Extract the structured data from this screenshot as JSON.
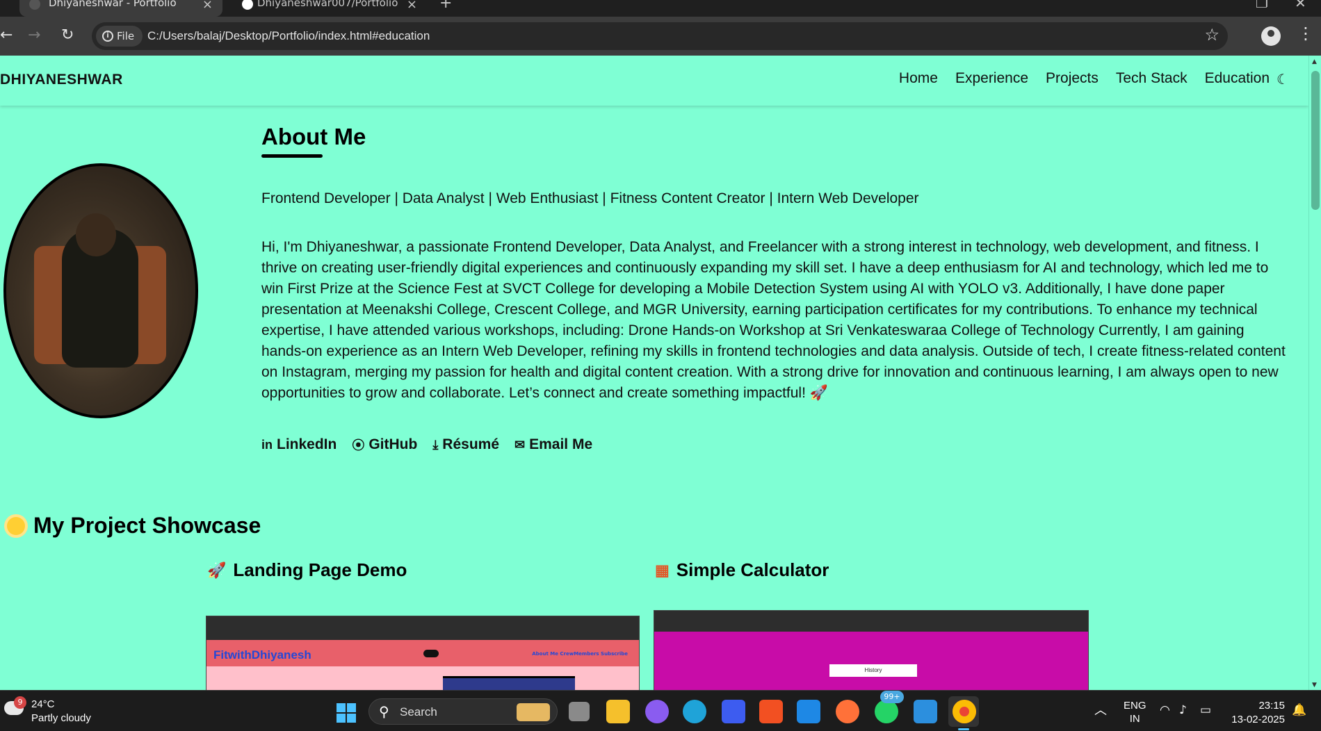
{
  "browser": {
    "tabs": [
      {
        "title": "Dhiyaneshwar - Portfolio",
        "active": true
      },
      {
        "title": "Dhiyaneshwar007/Portfolio",
        "active": false
      }
    ],
    "url_chip": "File",
    "url": "C:/Users/balaj/Desktop/Portfolio/index.html#education"
  },
  "site": {
    "brand": "DHIYANESHWAR",
    "nav": [
      "Home",
      "Experience",
      "Projects",
      "Tech Stack",
      "Education"
    ],
    "about": {
      "title": "About Me",
      "roles": "Frontend Developer | Data Analyst | Web Enthusiast | Fitness Content Creator | Intern Web Developer",
      "bio": "Hi, I'm Dhiyaneshwar, a passionate Frontend Developer, Data Analyst, and Freelancer with a strong interest in technology, web development, and fitness. I thrive on creating user-friendly digital experiences and continuously expanding my skill set. I have a deep enthusiasm for AI and technology, which led me to win First Prize at the Science Fest at SVCT College for developing a Mobile Detection System using AI with YOLO v3. Additionally, I have done paper presentation at Meenakshi College, Crescent College, and MGR University, earning participation certificates for my contributions. To enhance my technical expertise, I have attended various workshops, including: Drone Hands-on Workshop at Sri Venkateswaraa College of Technology Currently, I am gaining hands-on experience as an Intern Web Developer, refining my skills in frontend technologies and data analysis. Outside of tech, I create fitness-related content on Instagram, merging my passion for health and digital content creation. With a strong drive for innovation and continuous learning, I am always open to new opportunities to grow and collaborate. Let’s connect and create something impactful! 🚀",
      "links": [
        {
          "label": "LinkedIn",
          "icon": "in"
        },
        {
          "label": "GitHub",
          "icon": "⦿"
        },
        {
          "label": "Résumé",
          "icon": "⤓"
        },
        {
          "label": "Email Me",
          "icon": "✉"
        }
      ]
    },
    "showcase": {
      "title": "My Project Showcase",
      "projects": [
        {
          "title": "Landing Page Demo",
          "icon": "🚀",
          "thumb_brand": "FitwithDhiyanesh",
          "thumb_links": "About  Me  CrewMembers  Subscribe"
        },
        {
          "title": "Simple Calculator",
          "icon": "▦",
          "thumb_button": "History"
        }
      ]
    }
  },
  "taskbar": {
    "weather_badge": "9",
    "temp": "24°C",
    "weather": "Partly cloudy",
    "search": "Search",
    "badge": "99+",
    "lang_top": "ENG",
    "lang_bottom": "IN",
    "time": "23:15",
    "date": "13-02-2025"
  }
}
